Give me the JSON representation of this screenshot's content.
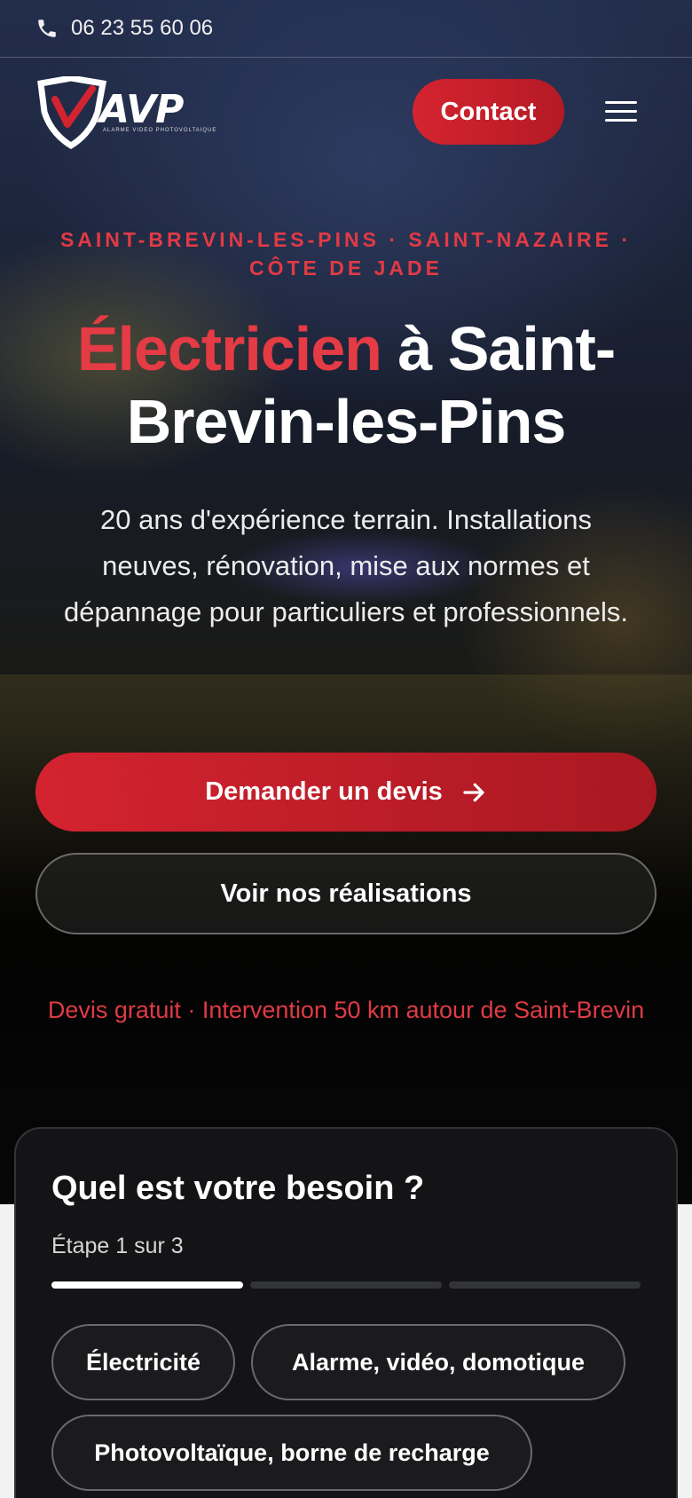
{
  "topbar": {
    "phone": "06 23 55 60 06",
    "phone_icon": "phone-icon"
  },
  "header": {
    "logo_text": "AVP",
    "logo_tagline": "ALARME VIDEO PHOTOVOLTAIQUE",
    "contact_label": "Contact",
    "menu_icon": "hamburger-menu-icon"
  },
  "hero": {
    "locations_line1": "SAINT-BREVIN-LES-PINS · SAINT-NAZAIRE ·",
    "locations_line2": "CÔTE DE JADE",
    "title_accent": "Électricien",
    "title_rest_1": " à Saint-",
    "title_rest_2": "Brevin-les-Pins",
    "subtitle": "20 ans d'expérience terrain. Installations neuves, rénovation, mise aux normes et dépannage pour particuliers et professionnels.",
    "primary_cta": "Demander un devis",
    "secondary_cta": "Voir nos réalisations",
    "note": "Devis gratuit · Intervention 50 km autour de Saint-Brevin"
  },
  "form": {
    "title": "Quel est votre besoin ?",
    "step_text": "Étape 1 sur 3",
    "current_step": 1,
    "total_steps": 3,
    "options": [
      "Électricité",
      "Alarme, vidéo, domotique",
      "Photovoltaïque, borne de recharge"
    ]
  },
  "colors": {
    "accent": "#e43b44",
    "button_red": "#d42330",
    "card_bg": "#141416"
  }
}
